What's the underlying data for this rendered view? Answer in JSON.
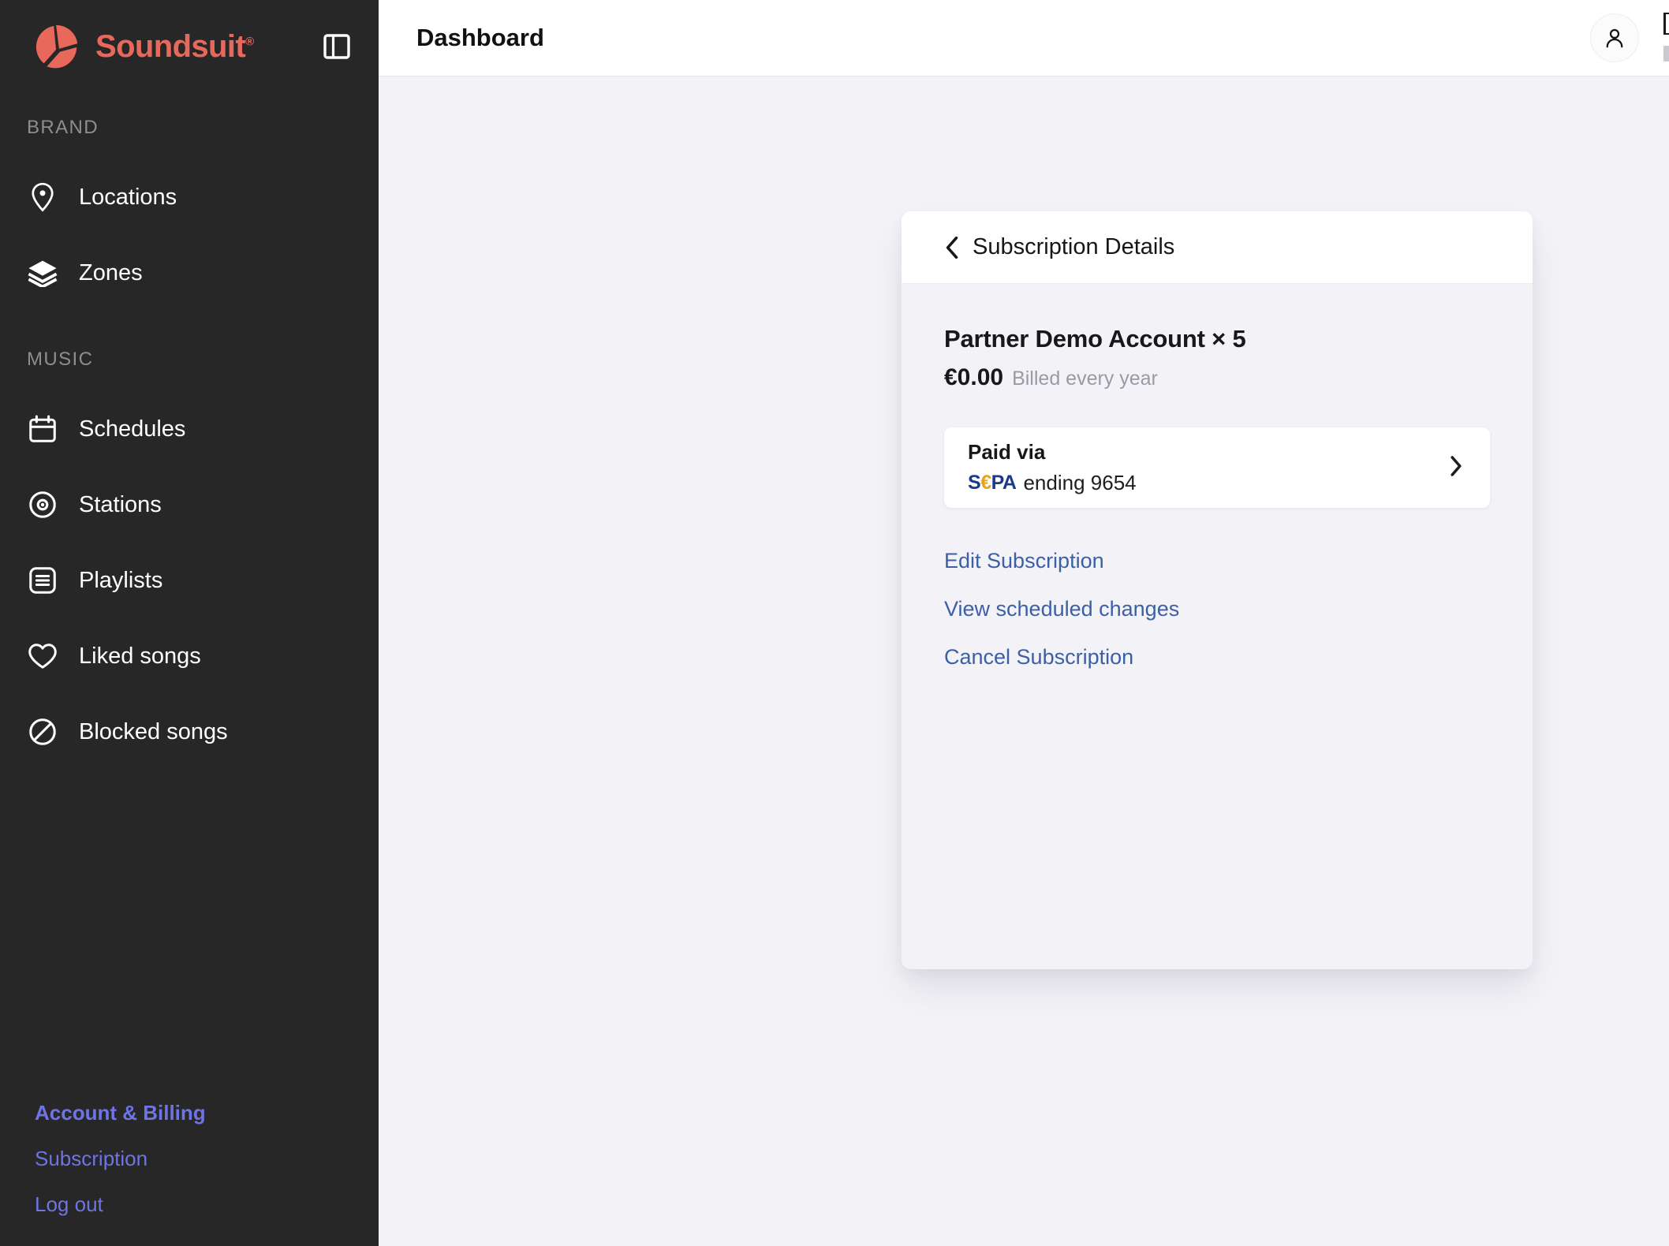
{
  "sidebar": {
    "brand": {
      "name": "Soundsuit",
      "registered_mark": "®",
      "logo_icon": "soundsuit-play-logo"
    },
    "panel_toggle_icon": "panel-toggle-icon",
    "sections": [
      {
        "label": "BRAND",
        "items": [
          {
            "label": "Locations",
            "icon": "map-pin-icon"
          },
          {
            "label": "Zones",
            "icon": "layers-icon"
          }
        ]
      },
      {
        "label": "MUSIC",
        "items": [
          {
            "label": "Schedules",
            "icon": "calendar-icon"
          },
          {
            "label": "Stations",
            "icon": "radio-disc-icon"
          },
          {
            "label": "Playlists",
            "icon": "list-box-icon"
          },
          {
            "label": "Liked songs",
            "icon": "heart-icon"
          },
          {
            "label": "Blocked songs",
            "icon": "ban-circle-icon"
          }
        ]
      }
    ],
    "account_links": [
      {
        "label": "Account & Billing",
        "bold": true
      },
      {
        "label": "Subscription",
        "bold": false
      },
      {
        "label": "Log out",
        "bold": false
      }
    ],
    "colors": {
      "background": "#272727",
      "brand_accent": "#e8695c",
      "link": "#6e74e4"
    }
  },
  "topbar": {
    "title": "Dashboard",
    "avatar_icon": "user-avatar-icon"
  },
  "subscription_card": {
    "header": {
      "title": "Subscription Details",
      "back_icon": "chevron-left-icon"
    },
    "plan": {
      "name": "Partner Demo Account × 5",
      "price": "€0.00",
      "billing_period": "Billed every year"
    },
    "payment_method": {
      "title": "Paid via",
      "provider": "SEPA",
      "provider_letters": {
        "s": "S",
        "euro": "€",
        "pa": "PA"
      },
      "detail": "ending 9654",
      "chevron_icon": "chevron-right-icon"
    },
    "actions": [
      {
        "label": "Edit Subscription"
      },
      {
        "label": "View scheduled changes"
      },
      {
        "label": "Cancel Subscription"
      }
    ],
    "colors": {
      "link": "#3c5fa6",
      "body_background": "#f2f2f7",
      "header_background": "#ffffff"
    }
  }
}
